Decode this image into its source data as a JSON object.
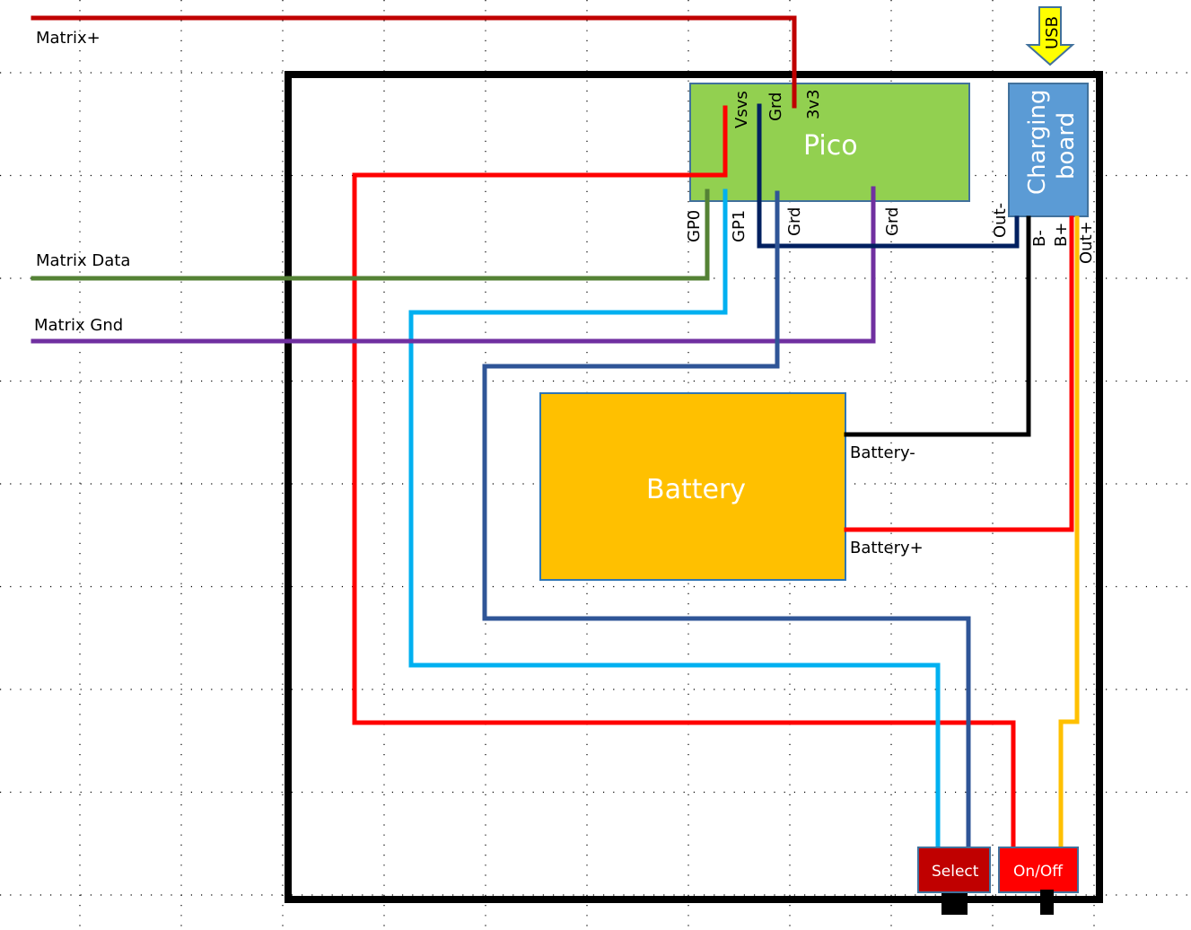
{
  "diagram": {
    "external_labels": {
      "matrix_plus": "Matrix+",
      "matrix_data": "Matrix Data",
      "matrix_gnd": "Matrix Gnd"
    },
    "pico": {
      "title": "Pico",
      "color": "#92d050",
      "top_pins": [
        "Vsvs",
        "Grd",
        "3v3"
      ],
      "bottom_pins": [
        "GP0",
        "GP1",
        "Grd",
        "Grd"
      ]
    },
    "charging_board": {
      "title_line1": "Charging",
      "title_line2": "board",
      "color": "#5b9bd5",
      "pins": [
        "Out-",
        "B-",
        "B+",
        "Out+"
      ]
    },
    "usb": {
      "label": "USB",
      "color": "#ffff00"
    },
    "battery": {
      "title": "Battery",
      "color": "#ffc000",
      "neg_label": "Battery-",
      "pos_label": "Battery+"
    },
    "buttons": {
      "select": {
        "label": "Select",
        "color": "#c00000"
      },
      "onoff": {
        "label": "On/Off",
        "color": "#ff0000"
      }
    },
    "wire_colors": {
      "matrix_plus": "#c00000",
      "vsys": "#ff0000",
      "gp0": "#548235",
      "gp1": "#00b0f0",
      "grd_top": "#002060",
      "grd_mid": "#2f5597",
      "grd_purple": "#7030a0",
      "black": "#000000",
      "out_plus": "#ffc000"
    }
  }
}
